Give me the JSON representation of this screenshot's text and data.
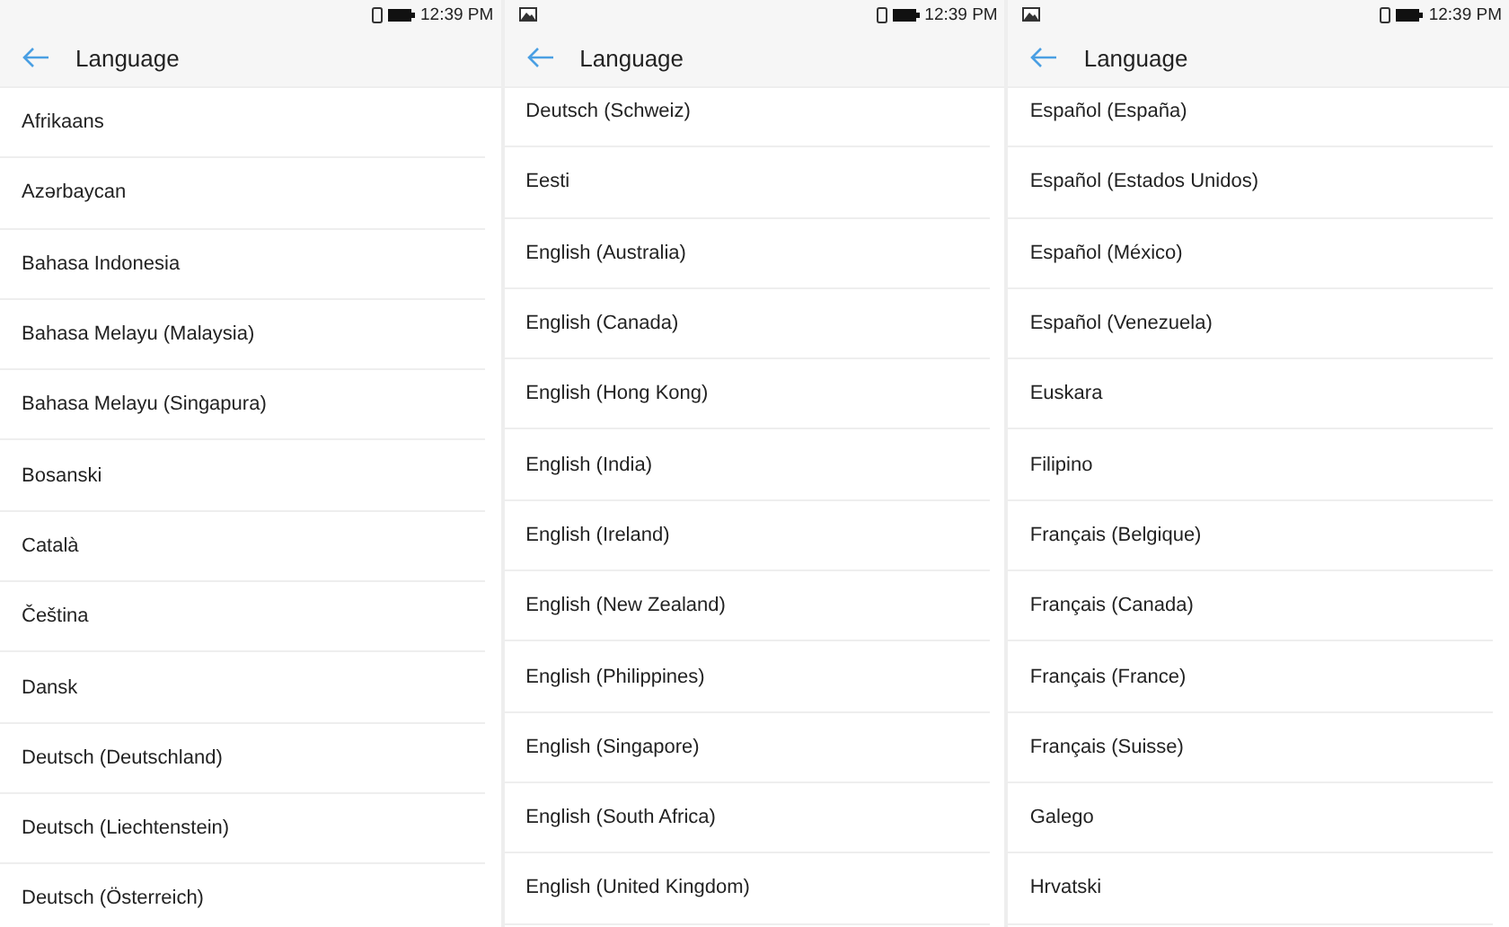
{
  "panels": [
    {
      "status": {
        "image_notification": false,
        "time": "12:39 PM"
      },
      "title": "Language",
      "scroll_offset": false,
      "items": [
        "Afrikaans",
        "Azərbaycan",
        "Bahasa Indonesia",
        "Bahasa Melayu (Malaysia)",
        "Bahasa Melayu (Singapura)",
        "Bosanski",
        "Català",
        "Čeština",
        "Dansk",
        "Deutsch (Deutschland)",
        "Deutsch (Liechtenstein)",
        "Deutsch (Österreich)"
      ]
    },
    {
      "status": {
        "image_notification": true,
        "time": "12:39 PM"
      },
      "title": "Language",
      "scroll_offset": true,
      "items": [
        "Deutsch (Schweiz)",
        "Eesti",
        "English (Australia)",
        "English (Canada)",
        "English (Hong Kong)",
        "English (India)",
        "English (Ireland)",
        "English (New Zealand)",
        "English (Philippines)",
        "English (Singapore)",
        "English (South Africa)",
        "English (United Kingdom)"
      ]
    },
    {
      "status": {
        "image_notification": true,
        "time": "12:39 PM"
      },
      "title": "Language",
      "scroll_offset": true,
      "items": [
        "Español (España)",
        "Español (Estados Unidos)",
        "Español (México)",
        "Español (Venezuela)",
        "Euskara",
        "Filipino",
        "Français (Belgique)",
        "Français (Canada)",
        "Français (France)",
        "Français (Suisse)",
        "Galego",
        "Hrvatski"
      ]
    }
  ]
}
